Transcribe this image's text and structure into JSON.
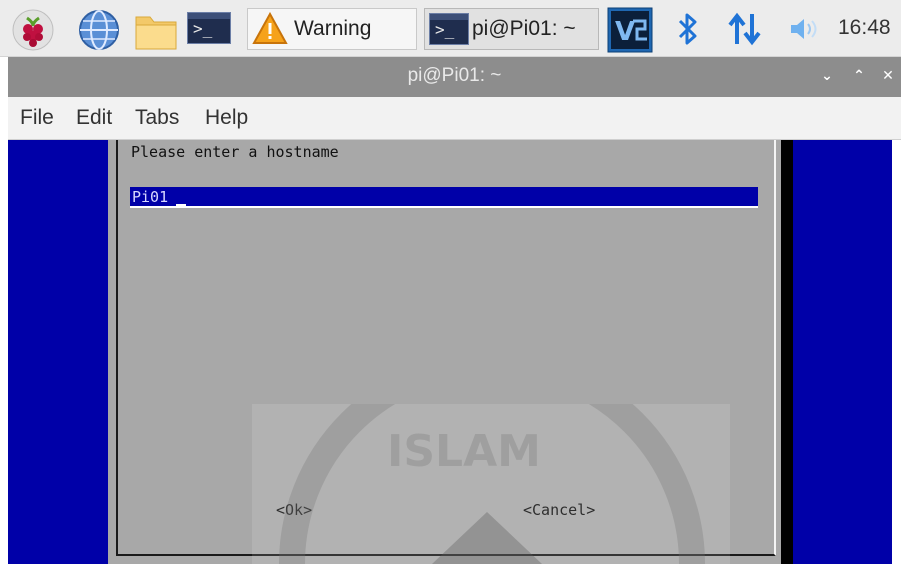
{
  "taskbar": {
    "tasks": [
      {
        "label": "Warning"
      },
      {
        "label": "pi@Pi01: ~"
      }
    ],
    "clock": "16:48",
    "icons": [
      "raspberry-menu-icon",
      "web-browser-icon",
      "file-manager-icon",
      "terminal-icon",
      "vnc-icon",
      "bluetooth-icon",
      "network-icon",
      "volume-icon"
    ]
  },
  "window": {
    "title": "pi@Pi01: ~",
    "controls": {
      "minimize": "⌄",
      "maximize": "⌃",
      "close": "✕"
    }
  },
  "menu": {
    "items": [
      "File",
      "Edit",
      "Tabs",
      "Help"
    ]
  },
  "dialog": {
    "prompt": "Please enter a hostname",
    "hostname_value": "Pi01",
    "ok_label": "<Ok>",
    "cancel_label": "<Cancel>"
  },
  "watermark": {
    "text": "ISLAM"
  },
  "colors": {
    "terminal_bg": "#0000a8",
    "dialog_bg": "#a8a8a8",
    "titlebar_bg": "#8d8d8d"
  }
}
